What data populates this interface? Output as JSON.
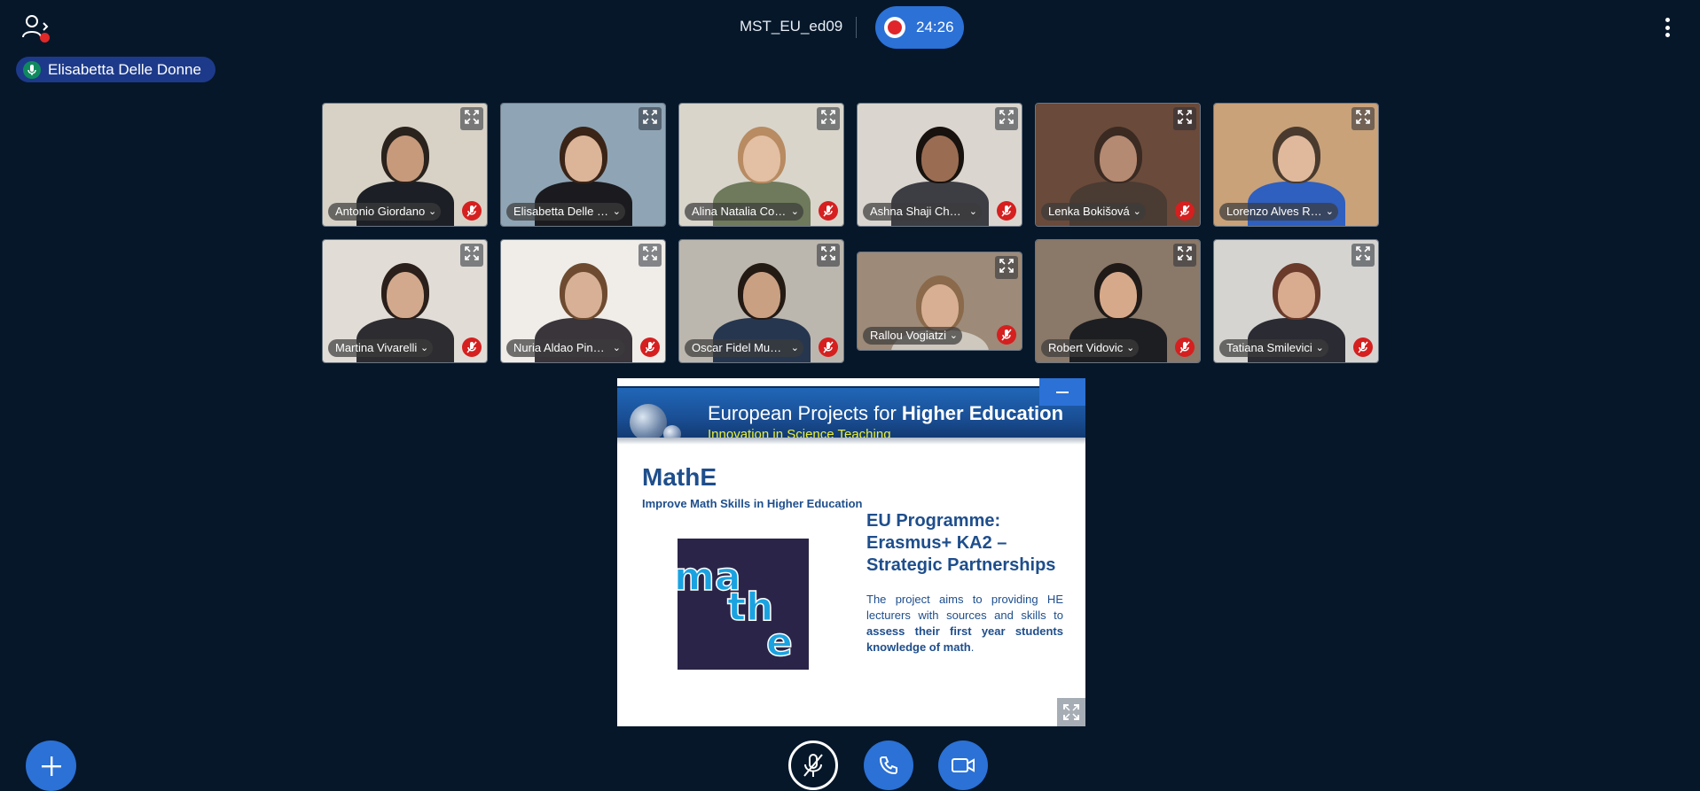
{
  "meeting": {
    "name": "MST_EU_ed09",
    "recording_time": "24:26"
  },
  "talking_indicator": {
    "name": "Elisabetta Delle Donne"
  },
  "participants": [
    {
      "name": "Antonio Giordano",
      "muted": true,
      "bg": "#d8d2c6",
      "skin": "#c79a7c",
      "hair": "#2a221c",
      "shirt": "#1c1f25"
    },
    {
      "name": "Elisabetta Delle Donne",
      "muted": false,
      "bg": "#8fa5b5",
      "skin": "#dcb497",
      "hair": "#3a2418",
      "shirt": "#1b1b1f"
    },
    {
      "name": "Alina Natalia Cos...",
      "muted": true,
      "bg": "#d9d5cb",
      "skin": "#e3bfa3",
      "hair": "#b88b62",
      "shirt": "#6e7a5b"
    },
    {
      "name": "Ashna Shaji Chan...",
      "muted": true,
      "bg": "#dad6cf",
      "skin": "#9a6d52",
      "hair": "#18120f",
      "shirt": "#3d3d44"
    },
    {
      "name": "Lenka Bokišová",
      "muted": true,
      "bg": "#6a4a3a",
      "skin": "#b58a72",
      "hair": "#3a2a22",
      "shirt": "#4a3b33"
    },
    {
      "name": "Lorenzo Alves Rebehy",
      "muted": false,
      "bg": "#c9a27a",
      "skin": "#e0b99c",
      "hair": "#4a3a2e",
      "shirt": "#2f5fbf"
    },
    {
      "name": "Martina Vivarelli",
      "muted": true,
      "bg": "#e1ddd6",
      "skin": "#d3a98d",
      "hair": "#2a1f1a",
      "shirt": "#2d2d31"
    },
    {
      "name": "Nuria Aldao Pineiro",
      "muted": true,
      "bg": "#f0ede8",
      "skin": "#d8b096",
      "hair": "#6e4b30",
      "shirt": "#39353a"
    },
    {
      "name": "Oscar Fidel Muno...",
      "muted": true,
      "bg": "#bcb7ae",
      "skin": "#caa083",
      "hair": "#241a14",
      "shirt": "#27364f"
    },
    {
      "name": "Rallou Vogiatzi",
      "muted": true,
      "bg": "#9d8a78",
      "skin": "#d8af92",
      "hair": "#8b6a4c",
      "shirt": "#cfc8be"
    },
    {
      "name": "Robert Vidovic",
      "muted": true,
      "bg": "#8a7868",
      "skin": "#d7a98b",
      "hair": "#1f1a17",
      "shirt": "#1d1e22"
    },
    {
      "name": "Tatiana Smilevici",
      "muted": true,
      "bg": "#d5d4d1",
      "skin": "#d9ac90",
      "hair": "#6a3a2a",
      "shirt": "#2b2b33"
    }
  ],
  "slide": {
    "banner_title_prefix": "European Projects for ",
    "banner_title_bold": "Higher Education",
    "banner_subtitle": "Innovation in Science Teaching",
    "title": "MathE",
    "subtitle": "Improve Math Skills in Higher Education",
    "logo_text": "mathe",
    "programme": "EU Programme: Erasmus+ KA2 – Strategic Partnerships",
    "desc_prefix": "The project aims to providing HE lecturers with sources and skills to ",
    "desc_bold": "assess their first year students knowledge of math",
    "desc_suffix": "."
  },
  "colors": {
    "background": "#06172a",
    "accent": "#2b71d6",
    "muted_red": "#d61f1f",
    "record_red": "#e0262a"
  },
  "icons": {
    "users": "users-icon",
    "mic": "microphone-icon",
    "record": "record-icon",
    "more": "kebab-menu-icon",
    "expand": "expand-icon",
    "muted": "microphone-muted-icon",
    "minimize": "minimize-icon",
    "fullscreen": "fullscreen-icon",
    "plus": "plus-icon",
    "phone": "phone-icon",
    "camera": "camera-icon"
  }
}
